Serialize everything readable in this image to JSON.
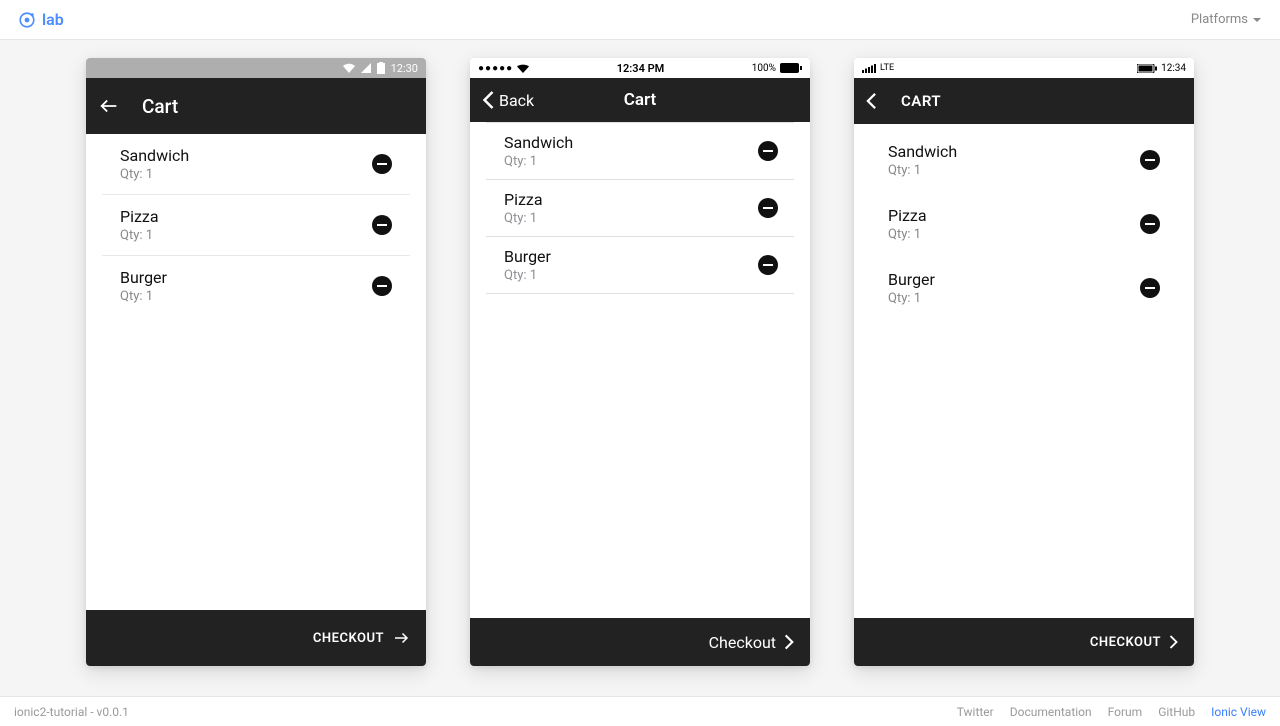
{
  "header": {
    "logo_text": "lab",
    "platforms_label": "Platforms"
  },
  "android": {
    "status_time": "12:30",
    "nav_title": "Cart",
    "items": [
      {
        "name": "Sandwich",
        "qty": "Qty: 1"
      },
      {
        "name": "Pizza",
        "qty": "Qty: 1"
      },
      {
        "name": "Burger",
        "qty": "Qty: 1"
      }
    ],
    "checkout": "CHECKOUT"
  },
  "ios": {
    "status_time": "12:34 PM",
    "status_battery": "100%",
    "back_label": "Back",
    "nav_title": "Cart",
    "items": [
      {
        "name": "Sandwich",
        "qty": "Qty: 1"
      },
      {
        "name": "Pizza",
        "qty": "Qty: 1"
      },
      {
        "name": "Burger",
        "qty": "Qty: 1"
      }
    ],
    "checkout": "Checkout"
  },
  "wp": {
    "status_network": "LTE",
    "status_time": "12:34",
    "nav_title": "CART",
    "items": [
      {
        "name": "Sandwich",
        "qty": "Qty: 1"
      },
      {
        "name": "Pizza",
        "qty": "Qty: 1"
      },
      {
        "name": "Burger",
        "qty": "Qty: 1"
      }
    ],
    "checkout": "CHECKOUT"
  },
  "footer": {
    "project": "ionic2-tutorial - v0.0.1",
    "links": {
      "twitter": "Twitter",
      "docs": "Documentation",
      "forum": "Forum",
      "github": "GitHub",
      "ionic_view": "Ionic View"
    }
  }
}
